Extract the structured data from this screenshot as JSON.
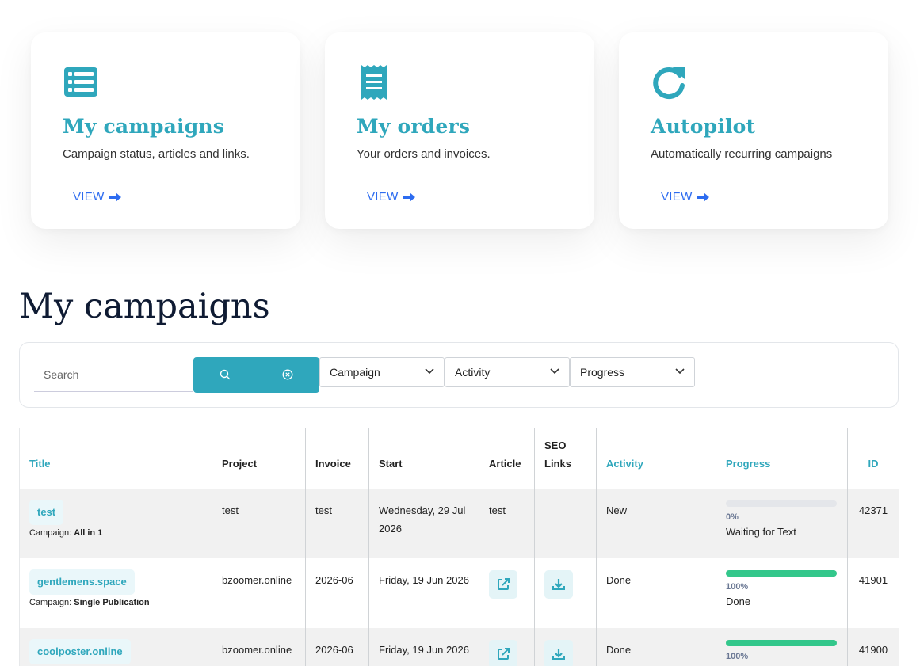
{
  "cards": [
    {
      "title": "My campaigns",
      "description": "Campaign status, articles and links.",
      "link": "VIEW",
      "icon": "list-icon"
    },
    {
      "title": "My orders",
      "description": "Your orders and invoices.",
      "link": "VIEW",
      "icon": "receipt-icon"
    },
    {
      "title": "Autopilot",
      "description": "Automatically recurring campaigns",
      "link": "VIEW",
      "icon": "refresh-icon"
    }
  ],
  "section": {
    "title": "My campaigns"
  },
  "filters": {
    "search_placeholder": "Search",
    "campaign_select": "Campaign",
    "activity_select": "Activity",
    "progress_select": "Progress"
  },
  "table": {
    "headers": {
      "title": "Title",
      "project": "Project",
      "invoice": "Invoice",
      "start": "Start",
      "article": "Article",
      "seo_links": "SEO Links",
      "activity": "Activity",
      "progress": "Progress",
      "id": "ID"
    },
    "campaign_prefix": "Campaign:",
    "rows": [
      {
        "title": "test",
        "campaign": "All in 1",
        "project": "test",
        "invoice": "test",
        "start": "Wednesday, 29 Jul 2026",
        "article": "test",
        "activity": "New",
        "progress_pct": "0%",
        "progress_value": 0,
        "progress_status": "Waiting for Text",
        "id": "42371"
      },
      {
        "title": "gentlemens.space",
        "campaign": "Single Publication",
        "project": "bzoomer.online",
        "invoice": "2026-06",
        "start": "Friday, 19 Jun 2026",
        "article": "",
        "activity": "Done",
        "progress_pct": "100%",
        "progress_value": 100,
        "progress_status": "Done",
        "id": "41901"
      },
      {
        "title": "coolposter.online",
        "campaign": "",
        "project": "bzoomer.online",
        "invoice": "2026-06",
        "start": "Friday, 19 Jun 2026",
        "article": "",
        "activity": "Done",
        "progress_pct": "100%",
        "progress_value": 100,
        "progress_status": "",
        "id": "41900"
      }
    ]
  },
  "colors": {
    "accent": "#2fa7bc",
    "link": "#2d6cf0",
    "progress": "#33c78b"
  }
}
